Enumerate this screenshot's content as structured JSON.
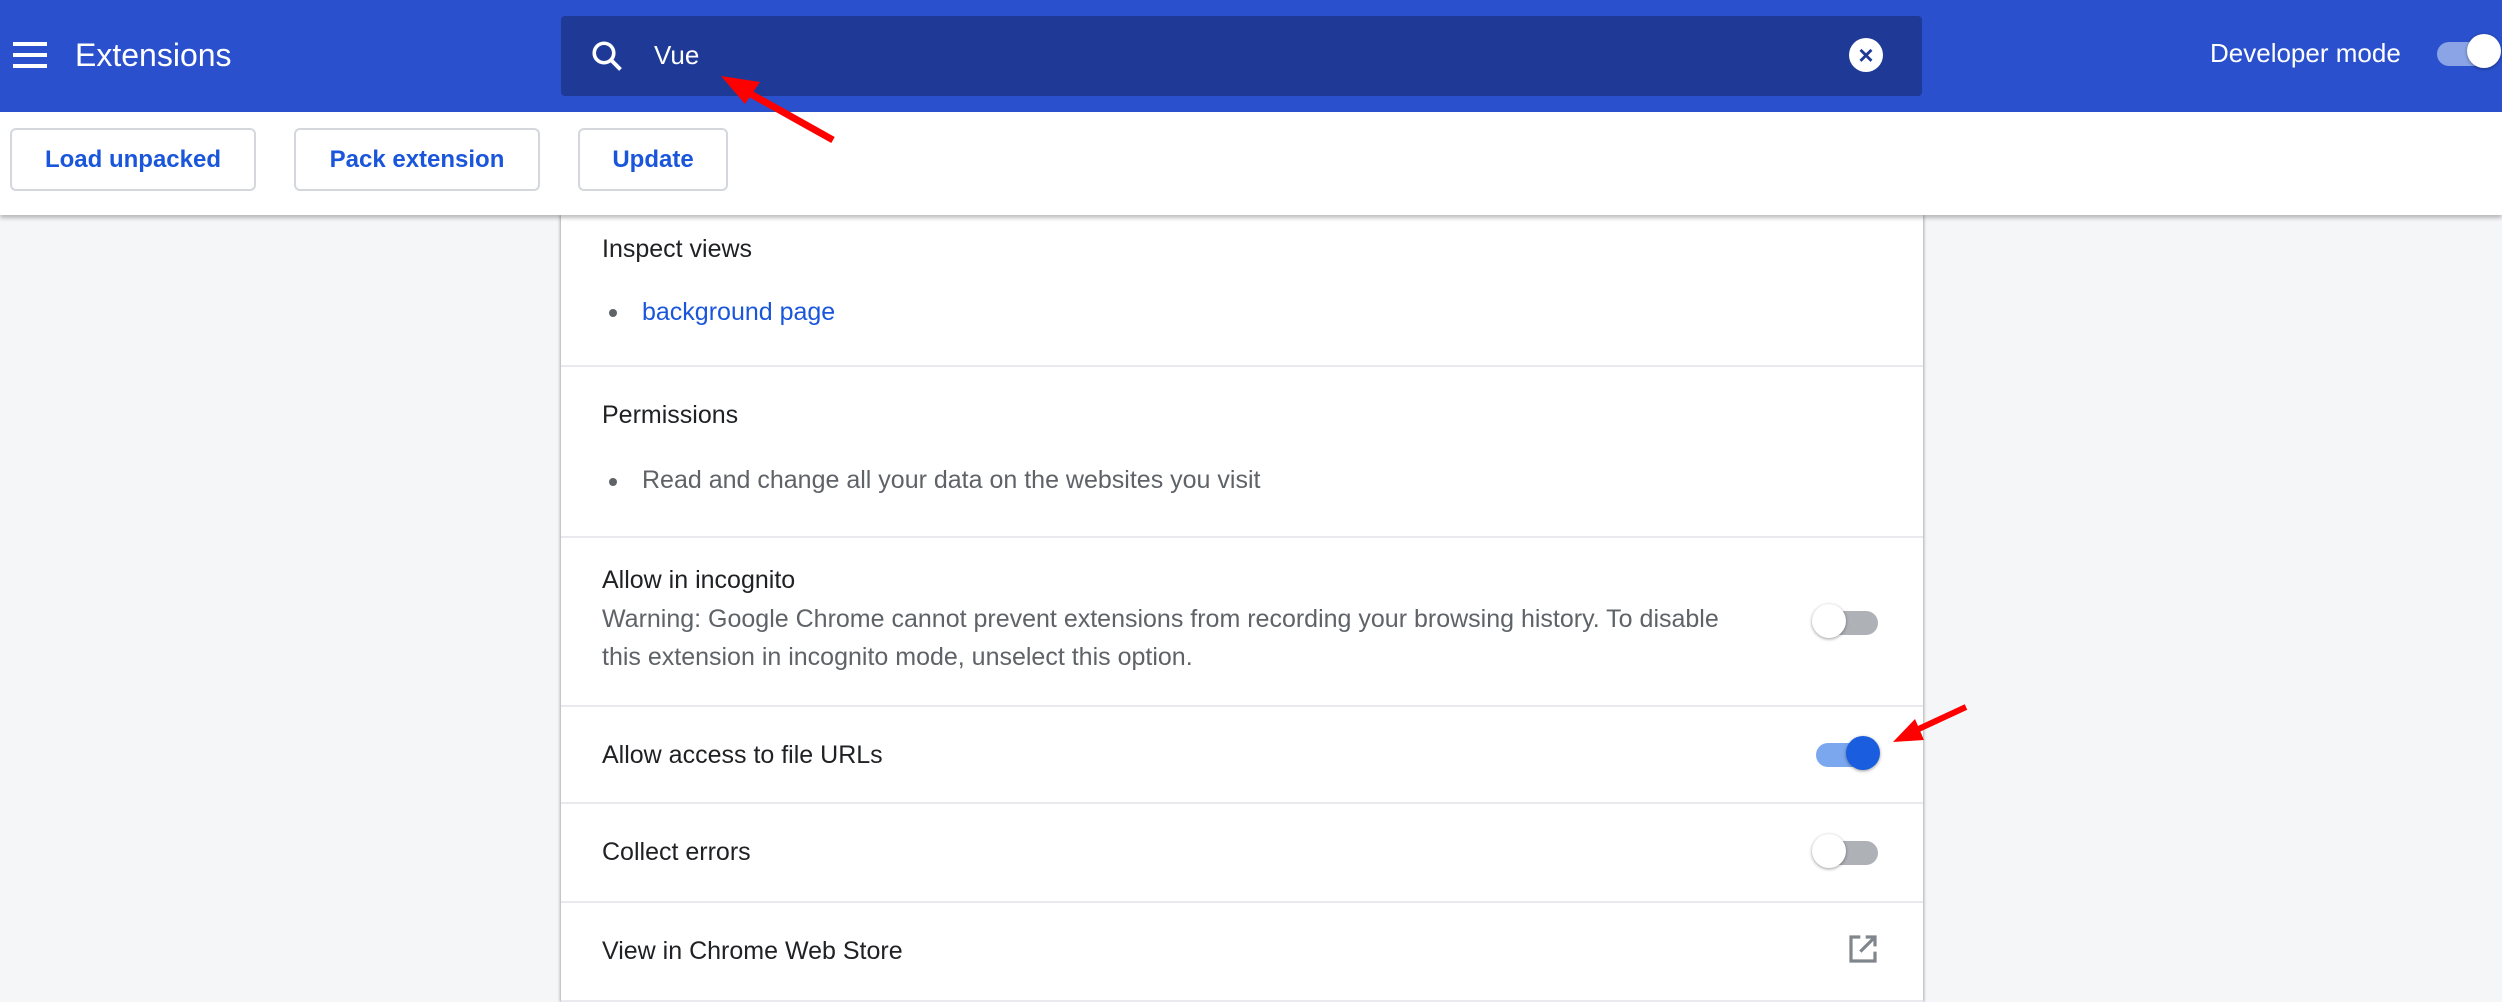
{
  "header": {
    "title": "Extensions",
    "search_value": "Vue",
    "developer_mode_label": "Developer mode",
    "developer_mode_on": true
  },
  "toolbar": {
    "load_unpacked": "Load unpacked",
    "pack_extension": "Pack extension",
    "update": "Update"
  },
  "details": {
    "inspect_views": {
      "heading": "Inspect views",
      "items": [
        "background page"
      ]
    },
    "permissions": {
      "heading": "Permissions",
      "items": [
        "Read and change all your data on the websites you visit"
      ]
    },
    "incognito": {
      "label": "Allow in incognito",
      "warning_line1": "Warning: Google Chrome cannot prevent extensions from recording your browsing history. To disable",
      "warning_line2": "this extension in incognito mode, unselect this option.",
      "enabled": false
    },
    "file_urls": {
      "label": "Allow access to file URLs",
      "enabled": true
    },
    "collect_errors": {
      "label": "Collect errors",
      "enabled": false
    },
    "web_store": {
      "label": "View in Chrome Web Store",
      "icon": "open-in-new-icon"
    }
  },
  "colors": {
    "header": "#2a50cd",
    "search": "#1f3a96",
    "accent": "#1a56db",
    "annotation": "#ff0000"
  }
}
